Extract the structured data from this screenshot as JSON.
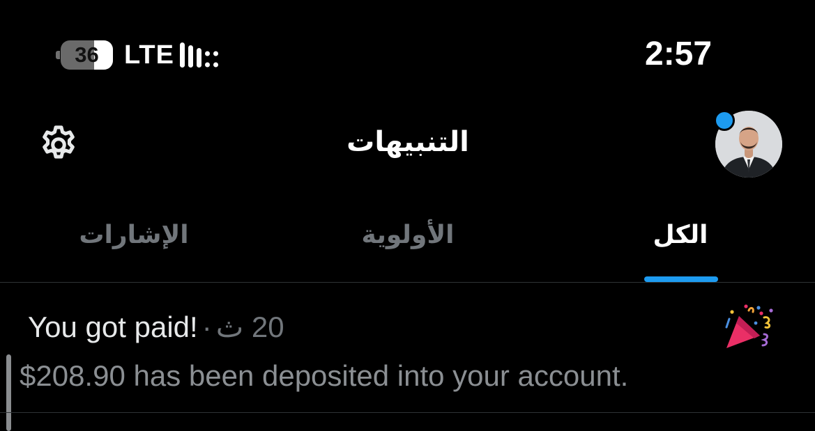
{
  "status_bar": {
    "battery_level": "36",
    "battery_fraction": 0.36,
    "network": "LTE",
    "signal_icon": "cellular-signal-icon",
    "time": "2:57"
  },
  "header": {
    "title": "التنبيهات",
    "settings_icon": "gear-icon",
    "avatar_icon": "profile-avatar",
    "unread_dot_color": "#1d9bf0"
  },
  "tabs": [
    {
      "label": "الكل",
      "active": true
    },
    {
      "label": "الأولوية",
      "active": false
    },
    {
      "label": "الإشارات",
      "active": false
    }
  ],
  "accent_color": "#1d9bf0",
  "notification": {
    "icon": "party-popper-icon",
    "title": "You got paid!",
    "separator": "·",
    "time": "20 ث",
    "body": "$208.90 has been deposited into your account."
  }
}
